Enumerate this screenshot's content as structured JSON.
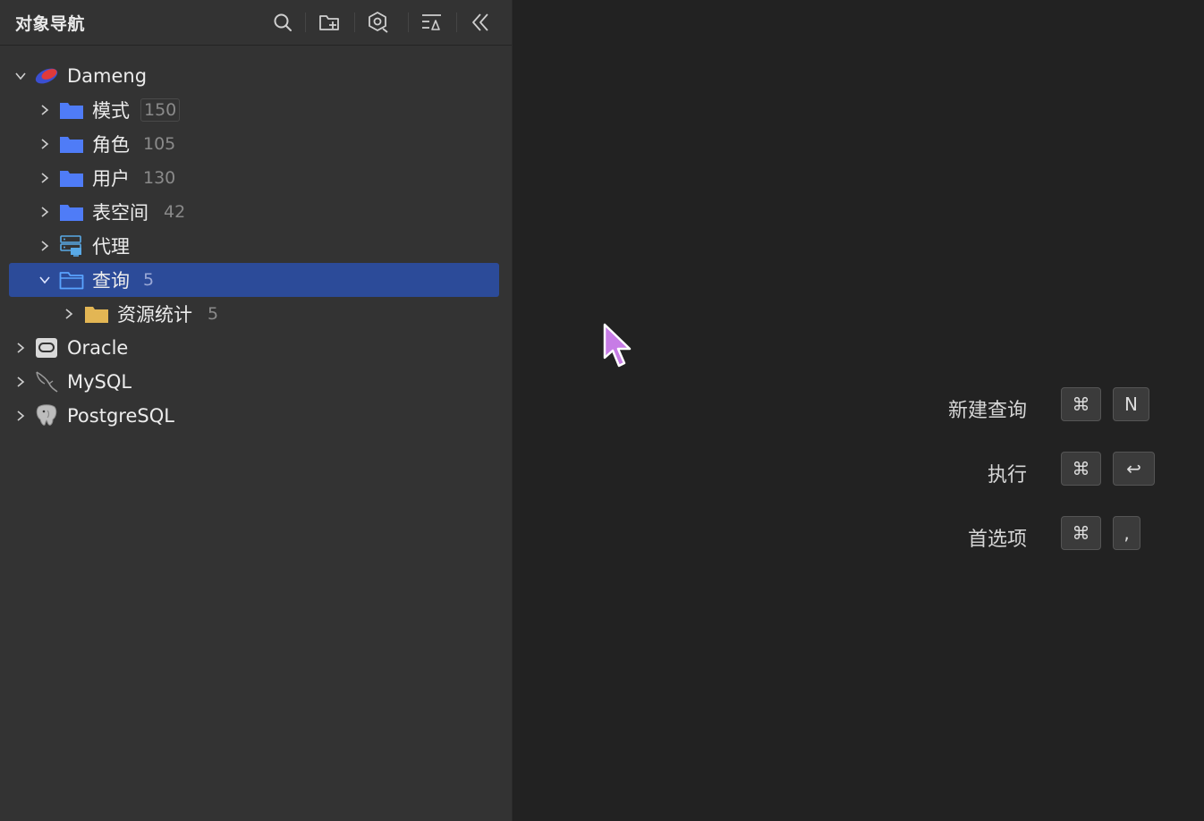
{
  "sidebar": {
    "title": "对象导航",
    "toolbar": [
      {
        "icon": "search-icon"
      },
      {
        "icon": "new-folder-icon"
      },
      {
        "icon": "filter-icon"
      },
      {
        "icon": "sort-icon"
      },
      {
        "icon": "collapse-icon"
      }
    ],
    "tree": [
      {
        "label": "Dameng",
        "icon": "dameng-db-icon",
        "expanded": true,
        "level": 0
      },
      {
        "label": "模式",
        "count": "150",
        "icon": "folder-icon",
        "level": 1
      },
      {
        "label": "角色",
        "count": "105",
        "icon": "folder-icon",
        "level": 1
      },
      {
        "label": "用户",
        "count": "130",
        "icon": "folder-icon",
        "level": 1
      },
      {
        "label": "表空间",
        "count": "42",
        "icon": "folder-icon",
        "level": 1
      },
      {
        "label": "代理",
        "icon": "agent-server-icon",
        "level": 1
      },
      {
        "label": "查询",
        "count": "5",
        "icon": "folder-open-icon",
        "expanded": true,
        "selected": true,
        "level": 1
      },
      {
        "label": "资源统计",
        "count": "5",
        "icon": "folder-yellow-icon",
        "level": 2
      },
      {
        "label": "Oracle",
        "icon": "oracle-db-icon",
        "level": 0
      },
      {
        "label": "MySQL",
        "icon": "mysql-db-icon",
        "level": 0
      },
      {
        "label": "PostgreSQL",
        "icon": "postgresql-db-icon",
        "level": 0
      }
    ]
  },
  "shortcuts": [
    {
      "label": "新建查询",
      "keys": [
        "⌘",
        "N"
      ]
    },
    {
      "label": "执行",
      "keys": [
        "⌘",
        "↩"
      ]
    },
    {
      "label": "首选项",
      "keys": [
        "⌘",
        ","
      ]
    }
  ],
  "colors": {
    "selection": "#2c4b99",
    "folder_blue": "#4f7cf7",
    "folder_yellow": "#e3b654",
    "cursor": "#c77ce6"
  }
}
